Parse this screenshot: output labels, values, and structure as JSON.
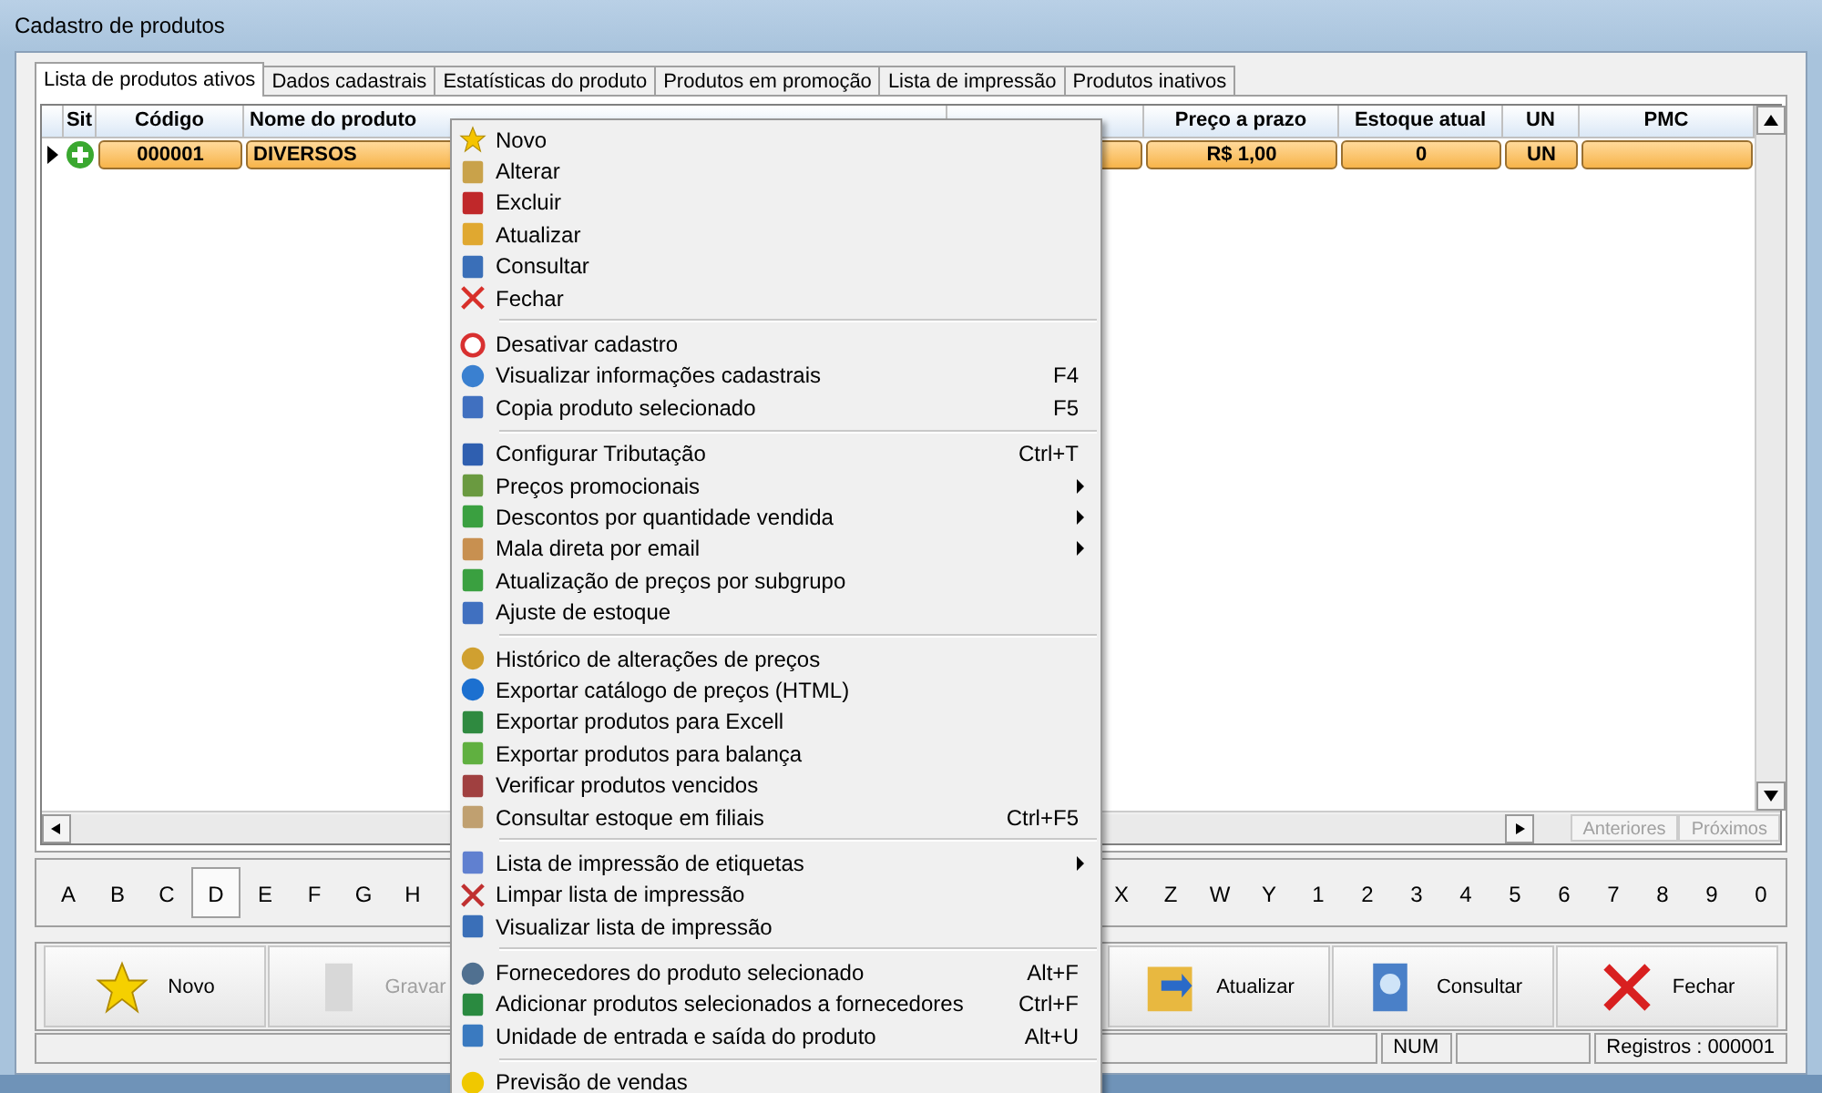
{
  "window": {
    "title": "Cadastro de produtos"
  },
  "tabs": [
    {
      "label": "Lista de produtos ativos",
      "selected": true
    },
    {
      "label": "Dados cadastrais",
      "selected": false
    },
    {
      "label": "Estatísticas do produto",
      "selected": false
    },
    {
      "label": "Produtos em promoção",
      "selected": false
    },
    {
      "label": "Lista de impressão",
      "selected": false
    },
    {
      "label": "Produtos inativos",
      "selected": false
    }
  ],
  "table": {
    "columns": [
      "Sit",
      "Código",
      "Nome do produto",
      "",
      "Preço a prazo",
      "Estoque atual",
      "UN",
      "PMC"
    ],
    "rows": [
      {
        "selected": true,
        "active": true,
        "cells": [
          "",
          "000001",
          "DIVERSOS",
          "",
          "R$ 1,00",
          "0",
          "UN",
          ""
        ]
      }
    ]
  },
  "pager": {
    "previous": "Anteriores",
    "next": "Próximos"
  },
  "letters_left": [
    {
      "label": "A",
      "selected": false
    },
    {
      "label": "B",
      "selected": false
    },
    {
      "label": "C",
      "selected": false
    },
    {
      "label": "D",
      "selected": true
    },
    {
      "label": "E",
      "selected": false
    },
    {
      "label": "F",
      "selected": false
    },
    {
      "label": "G",
      "selected": false
    },
    {
      "label": "H",
      "selected": false
    }
  ],
  "letters_right": [
    {
      "label": "X",
      "selected": false
    },
    {
      "label": "Z",
      "selected": false
    },
    {
      "label": "W",
      "selected": false
    },
    {
      "label": "Y",
      "selected": false
    },
    {
      "label": "1",
      "selected": false
    },
    {
      "label": "2",
      "selected": false
    },
    {
      "label": "3",
      "selected": false
    },
    {
      "label": "4",
      "selected": false
    },
    {
      "label": "5",
      "selected": false
    },
    {
      "label": "6",
      "selected": false
    },
    {
      "label": "7",
      "selected": false
    },
    {
      "label": "8",
      "selected": false
    },
    {
      "label": "9",
      "selected": false
    },
    {
      "label": "0",
      "selected": false
    }
  ],
  "buttons_left": [
    {
      "label": "Novo",
      "disabled": false
    },
    {
      "label": "Gravar",
      "disabled": true
    }
  ],
  "buttons_right": [
    {
      "label": "Atualizar",
      "disabled": false
    },
    {
      "label": "Consultar",
      "disabled": false
    },
    {
      "label": "Fechar",
      "disabled": false
    }
  ],
  "status_bar": {
    "num": "NUM",
    "records": "Registros : 000001"
  },
  "context_menu": [
    [
      {
        "label": "Novo"
      },
      {
        "label": "Alterar"
      },
      {
        "label": "Excluir"
      },
      {
        "label": "Atualizar"
      },
      {
        "label": "Consultar"
      },
      {
        "label": "Fechar"
      }
    ],
    [
      {
        "label": "Desativar cadastro"
      },
      {
        "label": "Visualizar informações cadastrais",
        "shortcut": "F4"
      },
      {
        "label": "Copia produto selecionado",
        "shortcut": "F5"
      }
    ],
    [
      {
        "label": "Configurar Tributação",
        "shortcut": "Ctrl+T"
      },
      {
        "label": "Preços promocionais",
        "submenu": true
      },
      {
        "label": "Descontos por quantidade vendida",
        "submenu": true
      },
      {
        "label": "Mala direta por email",
        "submenu": true
      },
      {
        "label": "Atualização de preços por subgrupo"
      },
      {
        "label": "Ajuste de estoque"
      }
    ],
    [
      {
        "label": "Histórico de alterações de preços"
      },
      {
        "label": "Exportar catálogo de preços (HTML)"
      },
      {
        "label": "Exportar produtos para Excell"
      },
      {
        "label": "Exportar produtos para balança"
      },
      {
        "label": "Verificar produtos vencidos"
      },
      {
        "label": "Consultar estoque em filiais",
        "shortcut": "Ctrl+F5"
      }
    ],
    [
      {
        "label": "Lista de impressão de etiquetas",
        "submenu": true
      },
      {
        "label": "Limpar lista de impressão"
      },
      {
        "label": "Visualizar lista de impressão"
      }
    ],
    [
      {
        "label": "Fornecedores do produto selecionado",
        "shortcut": "Alt+F"
      },
      {
        "label": "Adicionar produtos selecionados a fornecedores",
        "shortcut": "Ctrl+F"
      },
      {
        "label": "Unidade de entrada e saída do produto",
        "shortcut": "Alt+U"
      }
    ],
    [
      {
        "label": "Previsão de vendas"
      }
    ]
  ]
}
